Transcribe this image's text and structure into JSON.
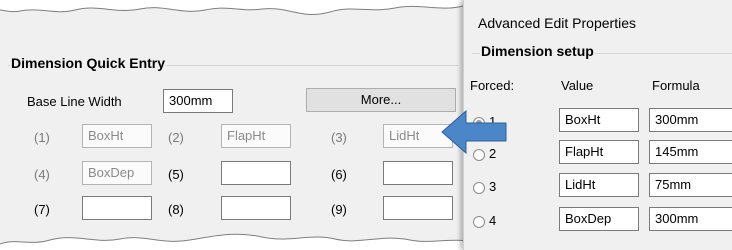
{
  "quick_entry": {
    "title": "Dimension Quick Entry",
    "base_line_label": "Base Line Width",
    "base_line_value": "300mm",
    "more_button": "More...",
    "rows": [
      {
        "n1": "(1)",
        "v1": "BoxHt",
        "n2": "(2)",
        "v2": "FlapHt",
        "n3": "(3)",
        "v3": "LidHt"
      },
      {
        "n1": "(4)",
        "v1": "BoxDep",
        "n2": "(5)",
        "v2": "",
        "n3": "(6)",
        "v3": ""
      },
      {
        "n1": "(7)",
        "v1": "",
        "n2": "(8)",
        "v2": "",
        "n3": "(9)",
        "v3": ""
      }
    ]
  },
  "advanced": {
    "title": "Advanced Edit Properties",
    "group_title": "Dimension setup",
    "col_forced": "Forced:",
    "col_value": "Value",
    "col_formula": "Formula",
    "rows": [
      {
        "forced": "1",
        "value": "BoxHt",
        "formula": "300mm",
        "selected": true
      },
      {
        "forced": "2",
        "value": "FlapHt",
        "formula": "145mm",
        "selected": false
      },
      {
        "forced": "3",
        "value": "LidHt",
        "formula": "75mm",
        "selected": false
      },
      {
        "forced": "4",
        "value": "BoxDep",
        "formula": "300mm",
        "selected": false
      }
    ]
  },
  "colors": {
    "arrow": "#4a86c8",
    "panel": "#f0f0f0"
  }
}
